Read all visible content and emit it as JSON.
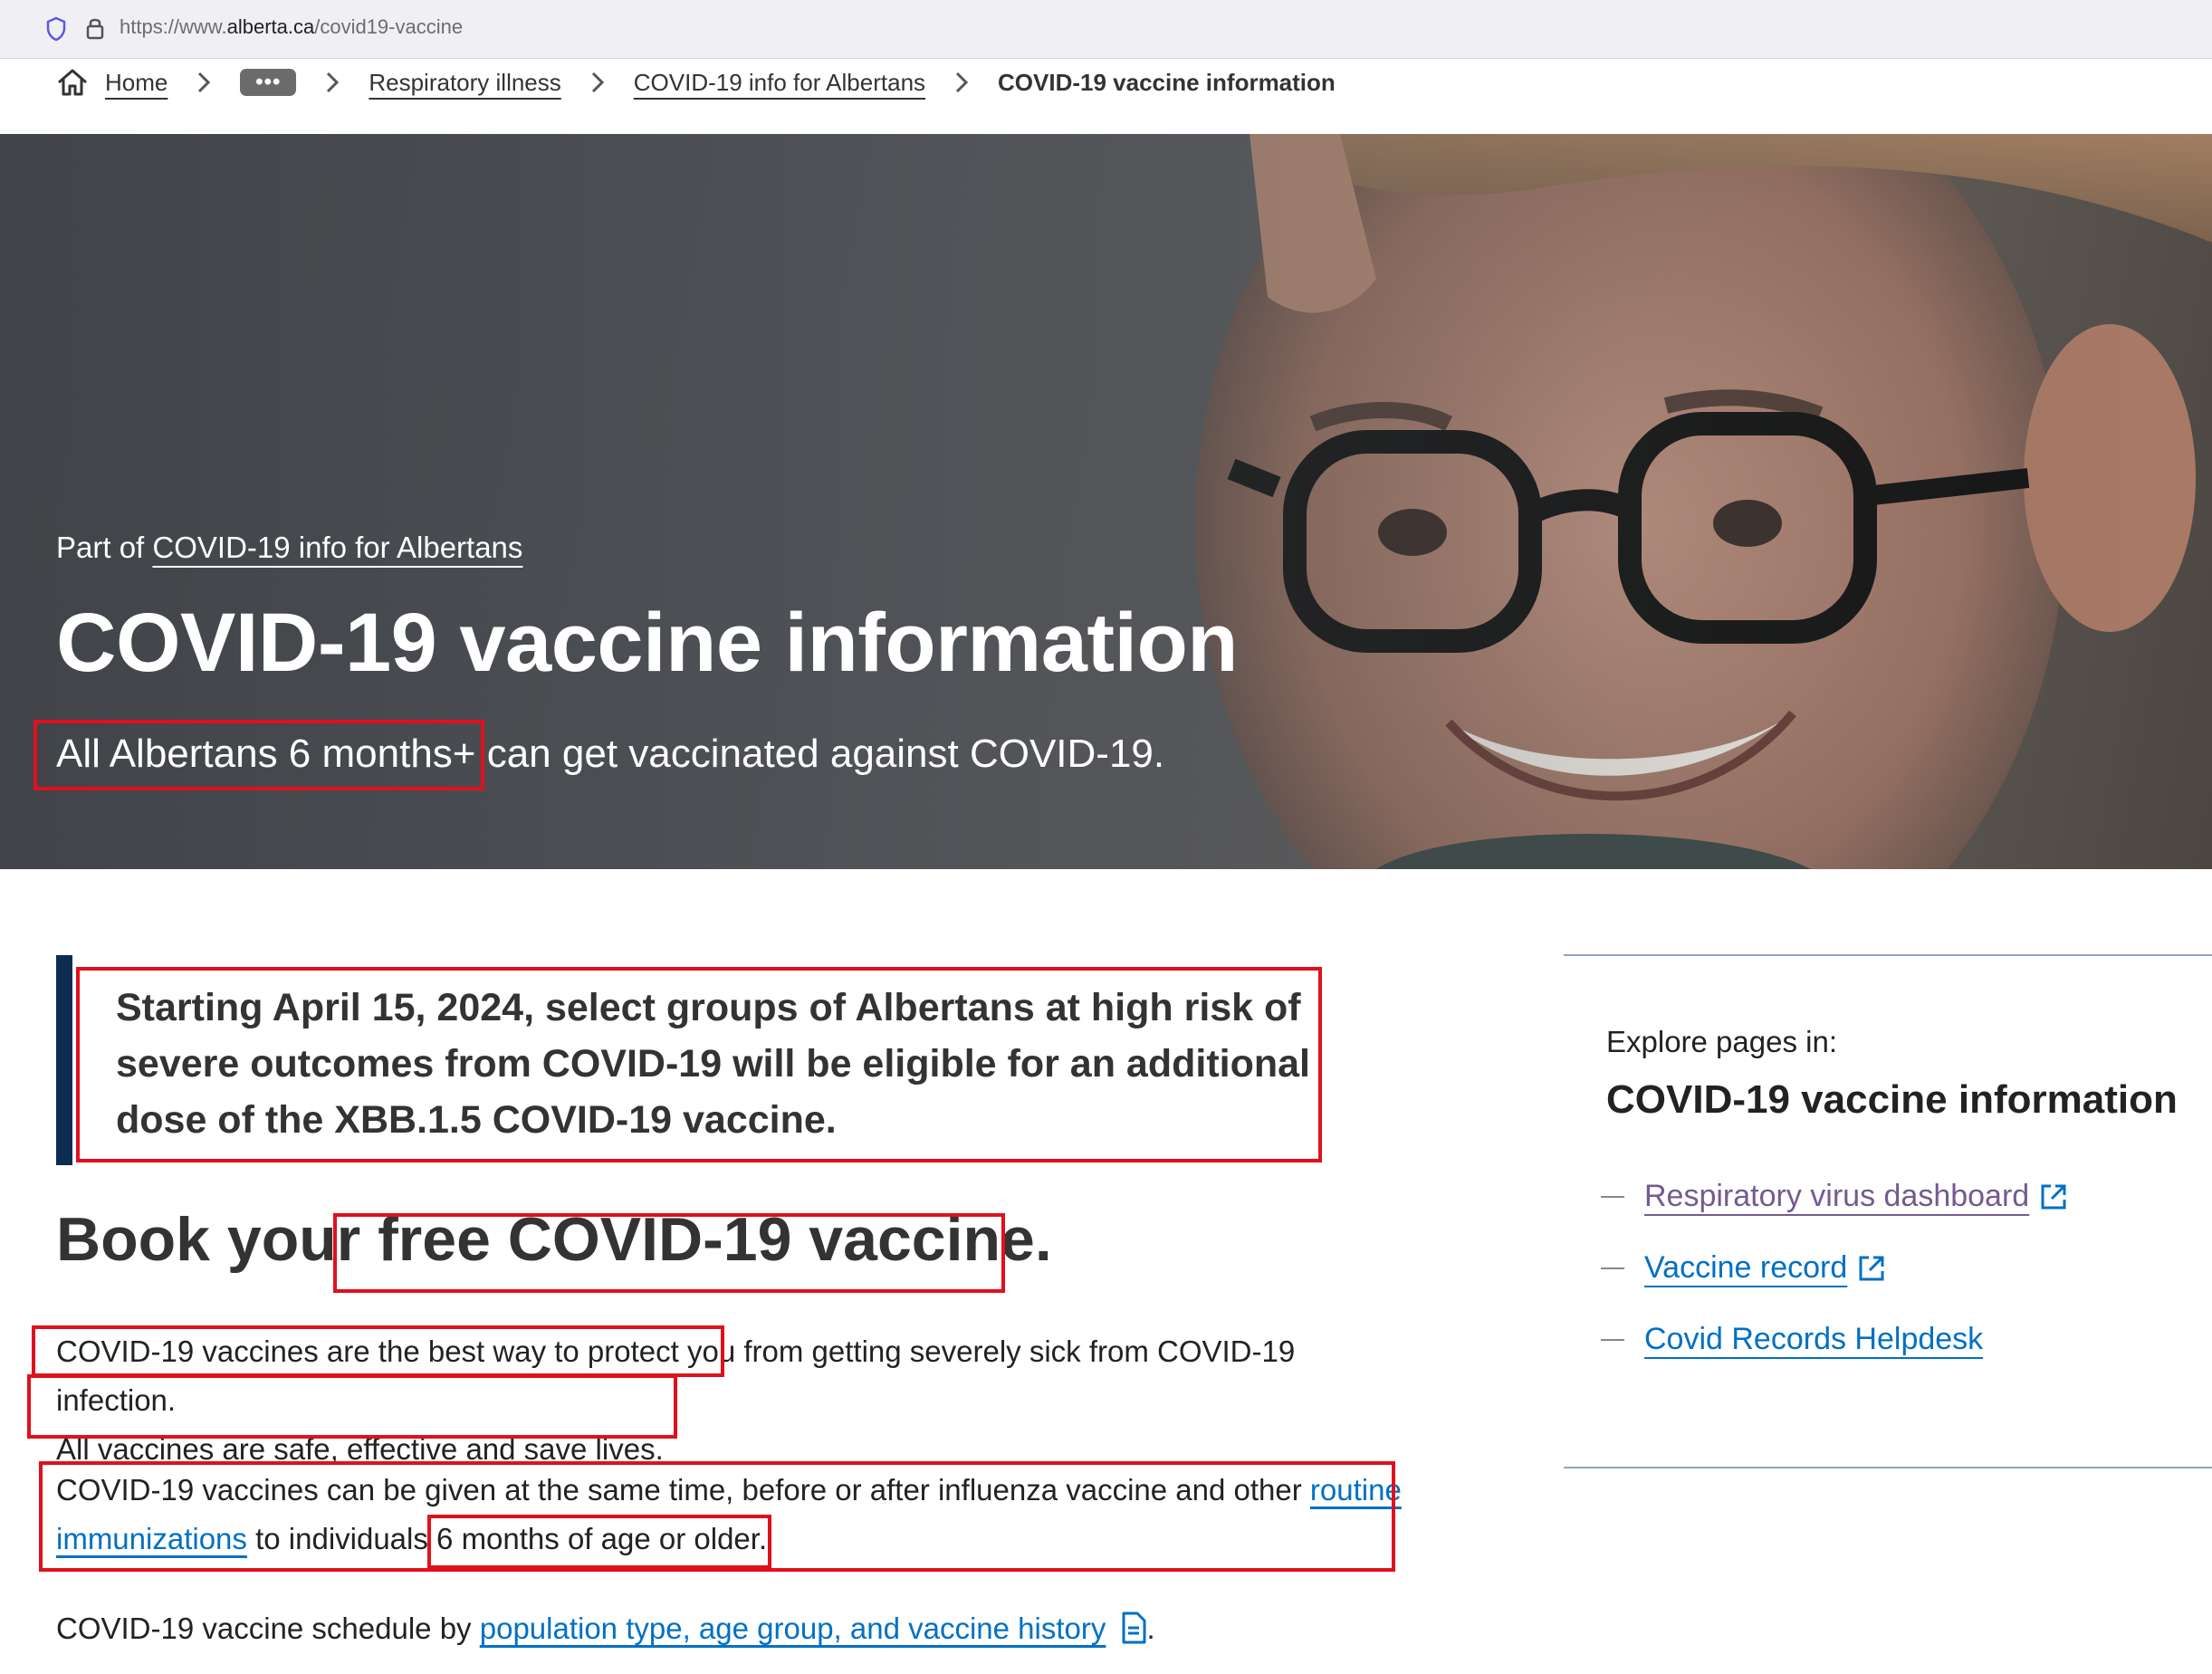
{
  "browser": {
    "url_prefix": "https://www.",
    "url_domain": "alberta.ca",
    "url_path": "/covid19-vaccine"
  },
  "breadcrumb": {
    "home": "Home",
    "more": "•••",
    "items": [
      "Respiratory illness",
      "COVID-19 info for Albertans"
    ],
    "current": "COVID-19 vaccine information"
  },
  "hero": {
    "part_of_prefix": "Part of ",
    "part_of_link": "COVID-19 info for Albertans",
    "title": "COVID-19 vaccine information",
    "subtitle_highlight": "All Albertans 6 months+",
    "subtitle_rest": " can get vaccinated against COVID-19."
  },
  "callout": {
    "text": "Starting April 15, 2024, select groups of Albertans at high risk of severe outcomes from COVID-19 will be eligible for an additional dose of the XBB.1.5 COVID-19 vaccine."
  },
  "book": {
    "prefix": "Book your",
    "highlight": " free COVID-19 vaccine."
  },
  "paragraphs": {
    "p1_part1": "COVID-19 vaccines are the best way to protect you",
    "p1_part2": " from getting severely sick from COVID-19 infection.",
    "p1_line2": "All vaccines are safe, effective and save lives.",
    "p2_text1": "COVID-19 vaccines can be given at the same time, before or after influenza vaccine and other ",
    "p2_link": "routine immunizations",
    "p2_text2": " to individuals ",
    "p2_text3": "6 months of age or older.",
    "p3_text": "COVID-19 vaccine schedule by ",
    "p3_link": "population type, age group, and vaccine history",
    "p3_end": "."
  },
  "sidebar": {
    "explore": "Explore pages in:",
    "title": "COVID-19 vaccine information",
    "links": [
      "Respiratory virus dashboard",
      "Vaccine record",
      "Covid Records Helpdesk"
    ]
  },
  "colors": {
    "link": "#0070c4",
    "visited_link": "#755a8e",
    "callout_bar": "#0c2d51",
    "annotation_red": "#e0101e"
  },
  "icons": [
    "shield-icon",
    "lock-icon",
    "home-icon",
    "chevron-right-icon",
    "external-link-icon",
    "document-icon"
  ]
}
